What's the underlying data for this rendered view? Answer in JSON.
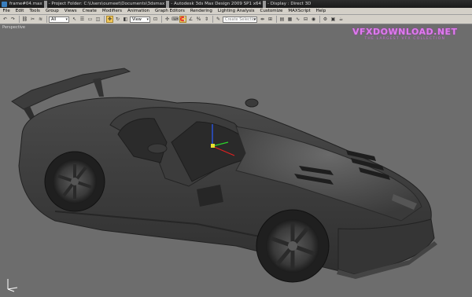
{
  "titlebar": {
    "file": "frame#04.max",
    "project": "- Project Folder: C:\\Users\\oumeet\\Documents\\3dsmax",
    "app": "- Autodesk 3ds Max Design 2009 SP1  x64",
    "display": "- Display : Direct 3D"
  },
  "menu": [
    "File",
    "Edit",
    "Tools",
    "Group",
    "Views",
    "Create",
    "Modifiers",
    "Animation",
    "Graph Editors",
    "Rendering",
    "Lighting Analysis",
    "Customize",
    "MAXScript",
    "Help"
  ],
  "toolbar": {
    "filter_value": "All",
    "refcoord_value": "View",
    "selection_set_placeholder": "Create Selection Set"
  },
  "viewport": {
    "label": "Perspective"
  },
  "watermark": {
    "title": "VFXDOWNLOAD.NET",
    "subtitle": "THE LARGEST VFX COLLECTION"
  },
  "colors": {
    "viewport_bg": "#6d6d6d",
    "watermark": "#e07af0",
    "active_tool": "#f3c85a"
  }
}
